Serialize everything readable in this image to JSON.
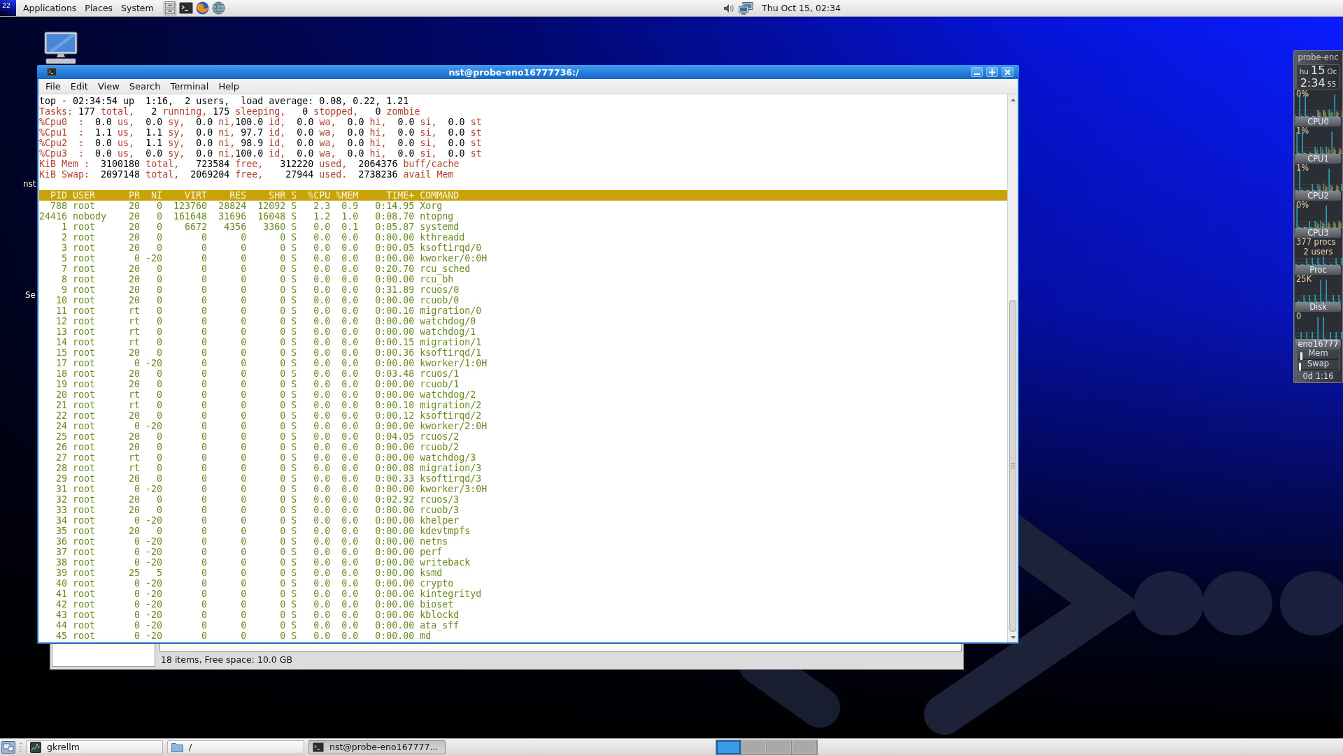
{
  "top_panel": {
    "logo_text": "22",
    "menus": [
      "Applications",
      "Places",
      "System"
    ],
    "clock": "Thu Oct 15, 02:34"
  },
  "desktop": {
    "icon_labels": [
      "nst",
      "Se"
    ]
  },
  "terminal": {
    "title": "nst@probe-eno16777736:/",
    "menus": [
      "File",
      "Edit",
      "View",
      "Search",
      "Terminal",
      "Help"
    ],
    "summary": [
      {
        "segments": [
          {
            "kind": "value",
            "text": "top - 02:34:54 up  1:16,  2 users,  load average: 0.08, 0.22, 1.21"
          }
        ]
      },
      {
        "segments": [
          {
            "kind": "label",
            "text": "Tasks:"
          },
          {
            "kind": "value",
            "text": " 177 "
          },
          {
            "kind": "label",
            "text": "total,"
          },
          {
            "kind": "value",
            "text": "   2 "
          },
          {
            "kind": "label",
            "text": "running,"
          },
          {
            "kind": "value",
            "text": " 175 "
          },
          {
            "kind": "label",
            "text": "sleeping,"
          },
          {
            "kind": "value",
            "text": "   0 "
          },
          {
            "kind": "label",
            "text": "stopped,"
          },
          {
            "kind": "value",
            "text": "   0 "
          },
          {
            "kind": "label",
            "text": "zombie"
          }
        ]
      },
      {
        "segments": [
          {
            "kind": "label",
            "text": "%Cpu0  :"
          },
          {
            "kind": "value",
            "text": "  0.0 "
          },
          {
            "kind": "label",
            "text": "us,"
          },
          {
            "kind": "value",
            "text": "  0.0 "
          },
          {
            "kind": "label",
            "text": "sy,"
          },
          {
            "kind": "value",
            "text": "  0.0 "
          },
          {
            "kind": "label",
            "text": "ni,"
          },
          {
            "kind": "value",
            "text": "100.0 "
          },
          {
            "kind": "label",
            "text": "id,"
          },
          {
            "kind": "value",
            "text": "  0.0 "
          },
          {
            "kind": "label",
            "text": "wa,"
          },
          {
            "kind": "value",
            "text": "  0.0 "
          },
          {
            "kind": "label",
            "text": "hi,"
          },
          {
            "kind": "value",
            "text": "  0.0 "
          },
          {
            "kind": "label",
            "text": "si,"
          },
          {
            "kind": "value",
            "text": "  0.0 "
          },
          {
            "kind": "label",
            "text": "st"
          }
        ]
      },
      {
        "segments": [
          {
            "kind": "label",
            "text": "%Cpu1  :"
          },
          {
            "kind": "value",
            "text": "  1.1 "
          },
          {
            "kind": "label",
            "text": "us,"
          },
          {
            "kind": "value",
            "text": "  1.1 "
          },
          {
            "kind": "label",
            "text": "sy,"
          },
          {
            "kind": "value",
            "text": "  0.0 "
          },
          {
            "kind": "label",
            "text": "ni,"
          },
          {
            "kind": "value",
            "text": " 97.7 "
          },
          {
            "kind": "label",
            "text": "id,"
          },
          {
            "kind": "value",
            "text": "  0.0 "
          },
          {
            "kind": "label",
            "text": "wa,"
          },
          {
            "kind": "value",
            "text": "  0.0 "
          },
          {
            "kind": "label",
            "text": "hi,"
          },
          {
            "kind": "value",
            "text": "  0.0 "
          },
          {
            "kind": "label",
            "text": "si,"
          },
          {
            "kind": "value",
            "text": "  0.0 "
          },
          {
            "kind": "label",
            "text": "st"
          }
        ]
      },
      {
        "segments": [
          {
            "kind": "label",
            "text": "%Cpu2  :"
          },
          {
            "kind": "value",
            "text": "  0.0 "
          },
          {
            "kind": "label",
            "text": "us,"
          },
          {
            "kind": "value",
            "text": "  1.1 "
          },
          {
            "kind": "label",
            "text": "sy,"
          },
          {
            "kind": "value",
            "text": "  0.0 "
          },
          {
            "kind": "label",
            "text": "ni,"
          },
          {
            "kind": "value",
            "text": " 98.9 "
          },
          {
            "kind": "label",
            "text": "id,"
          },
          {
            "kind": "value",
            "text": "  0.0 "
          },
          {
            "kind": "label",
            "text": "wa,"
          },
          {
            "kind": "value",
            "text": "  0.0 "
          },
          {
            "kind": "label",
            "text": "hi,"
          },
          {
            "kind": "value",
            "text": "  0.0 "
          },
          {
            "kind": "label",
            "text": "si,"
          },
          {
            "kind": "value",
            "text": "  0.0 "
          },
          {
            "kind": "label",
            "text": "st"
          }
        ]
      },
      {
        "segments": [
          {
            "kind": "label",
            "text": "%Cpu3  :"
          },
          {
            "kind": "value",
            "text": "  0.0 "
          },
          {
            "kind": "label",
            "text": "us,"
          },
          {
            "kind": "value",
            "text": "  0.0 "
          },
          {
            "kind": "label",
            "text": "sy,"
          },
          {
            "kind": "value",
            "text": "  0.0 "
          },
          {
            "kind": "label",
            "text": "ni,"
          },
          {
            "kind": "value",
            "text": "100.0 "
          },
          {
            "kind": "label",
            "text": "id,"
          },
          {
            "kind": "value",
            "text": "  0.0 "
          },
          {
            "kind": "label",
            "text": "wa,"
          },
          {
            "kind": "value",
            "text": "  0.0 "
          },
          {
            "kind": "label",
            "text": "hi,"
          },
          {
            "kind": "value",
            "text": "  0.0 "
          },
          {
            "kind": "label",
            "text": "si,"
          },
          {
            "kind": "value",
            "text": "  0.0 "
          },
          {
            "kind": "label",
            "text": "st"
          }
        ]
      },
      {
        "segments": [
          {
            "kind": "label",
            "text": "KiB Mem :"
          },
          {
            "kind": "value",
            "text": "  3100180 "
          },
          {
            "kind": "label",
            "text": "total,"
          },
          {
            "kind": "value",
            "text": "   723584 "
          },
          {
            "kind": "label",
            "text": "free,"
          },
          {
            "kind": "value",
            "text": "   312220 "
          },
          {
            "kind": "label",
            "text": "used,"
          },
          {
            "kind": "value",
            "text": "  2064376 "
          },
          {
            "kind": "label",
            "text": "buff/cache"
          }
        ]
      },
      {
        "segments": [
          {
            "kind": "label",
            "text": "KiB Swap:"
          },
          {
            "kind": "value",
            "text": "  2097148 "
          },
          {
            "kind": "label",
            "text": "total,"
          },
          {
            "kind": "value",
            "text": "  2069204 "
          },
          {
            "kind": "label",
            "text": "free,"
          },
          {
            "kind": "value",
            "text": "    27944 "
          },
          {
            "kind": "label",
            "text": "used."
          },
          {
            "kind": "value",
            "text": "  2738236 "
          },
          {
            "kind": "label",
            "text": "avail Mem"
          }
        ]
      }
    ],
    "process_table": {
      "columns": [
        "PID",
        "USER",
        "PR",
        "NI",
        "VIRT",
        "RES",
        "SHR",
        "S",
        "%CPU",
        "%MEM",
        "TIME+",
        "COMMAND"
      ],
      "rows": [
        [
          "788",
          "root",
          "20",
          "0",
          "123760",
          "28824",
          "12092",
          "S",
          "2.3",
          "0.9",
          "0:14.95",
          "Xorg"
        ],
        [
          "24416",
          "nobody",
          "20",
          "0",
          "161648",
          "31696",
          "16048",
          "S",
          "1.2",
          "1.0",
          "0:08.70",
          "ntopng"
        ],
        [
          "1",
          "root",
          "20",
          "0",
          "6672",
          "4356",
          "3360",
          "S",
          "0.0",
          "0.1",
          "0:05.87",
          "systemd"
        ],
        [
          "2",
          "root",
          "20",
          "0",
          "0",
          "0",
          "0",
          "S",
          "0.0",
          "0.0",
          "0:00.00",
          "kthreadd"
        ],
        [
          "3",
          "root",
          "20",
          "0",
          "0",
          "0",
          "0",
          "S",
          "0.0",
          "0.0",
          "0:00.05",
          "ksoftirqd/0"
        ],
        [
          "5",
          "root",
          "0",
          "-20",
          "0",
          "0",
          "0",
          "S",
          "0.0",
          "0.0",
          "0:00.00",
          "kworker/0:0H"
        ],
        [
          "7",
          "root",
          "20",
          "0",
          "0",
          "0",
          "0",
          "S",
          "0.0",
          "0.0",
          "0:20.70",
          "rcu_sched"
        ],
        [
          "8",
          "root",
          "20",
          "0",
          "0",
          "0",
          "0",
          "S",
          "0.0",
          "0.0",
          "0:00.00",
          "rcu_bh"
        ],
        [
          "9",
          "root",
          "20",
          "0",
          "0",
          "0",
          "0",
          "S",
          "0.0",
          "0.0",
          "0:31.89",
          "rcuos/0"
        ],
        [
          "10",
          "root",
          "20",
          "0",
          "0",
          "0",
          "0",
          "S",
          "0.0",
          "0.0",
          "0:00.00",
          "rcuob/0"
        ],
        [
          "11",
          "root",
          "rt",
          "0",
          "0",
          "0",
          "0",
          "S",
          "0.0",
          "0.0",
          "0:00.10",
          "migration/0"
        ],
        [
          "12",
          "root",
          "rt",
          "0",
          "0",
          "0",
          "0",
          "S",
          "0.0",
          "0.0",
          "0:00.00",
          "watchdog/0"
        ],
        [
          "13",
          "root",
          "rt",
          "0",
          "0",
          "0",
          "0",
          "S",
          "0.0",
          "0.0",
          "0:00.00",
          "watchdog/1"
        ],
        [
          "14",
          "root",
          "rt",
          "0",
          "0",
          "0",
          "0",
          "S",
          "0.0",
          "0.0",
          "0:00.15",
          "migration/1"
        ],
        [
          "15",
          "root",
          "20",
          "0",
          "0",
          "0",
          "0",
          "S",
          "0.0",
          "0.0",
          "0:00.36",
          "ksoftirqd/1"
        ],
        [
          "17",
          "root",
          "0",
          "-20",
          "0",
          "0",
          "0",
          "S",
          "0.0",
          "0.0",
          "0:00.00",
          "kworker/1:0H"
        ],
        [
          "18",
          "root",
          "20",
          "0",
          "0",
          "0",
          "0",
          "S",
          "0.0",
          "0.0",
          "0:03.48",
          "rcuos/1"
        ],
        [
          "19",
          "root",
          "20",
          "0",
          "0",
          "0",
          "0",
          "S",
          "0.0",
          "0.0",
          "0:00.00",
          "rcuob/1"
        ],
        [
          "20",
          "root",
          "rt",
          "0",
          "0",
          "0",
          "0",
          "S",
          "0.0",
          "0.0",
          "0:00.00",
          "watchdog/2"
        ],
        [
          "21",
          "root",
          "rt",
          "0",
          "0",
          "0",
          "0",
          "S",
          "0.0",
          "0.0",
          "0:00.10",
          "migration/2"
        ],
        [
          "22",
          "root",
          "20",
          "0",
          "0",
          "0",
          "0",
          "S",
          "0.0",
          "0.0",
          "0:00.12",
          "ksoftirqd/2"
        ],
        [
          "24",
          "root",
          "0",
          "-20",
          "0",
          "0",
          "0",
          "S",
          "0.0",
          "0.0",
          "0:00.00",
          "kworker/2:0H"
        ],
        [
          "25",
          "root",
          "20",
          "0",
          "0",
          "0",
          "0",
          "S",
          "0.0",
          "0.0",
          "0:04.05",
          "rcuos/2"
        ],
        [
          "26",
          "root",
          "20",
          "0",
          "0",
          "0",
          "0",
          "S",
          "0.0",
          "0.0",
          "0:00.00",
          "rcuob/2"
        ],
        [
          "27",
          "root",
          "rt",
          "0",
          "0",
          "0",
          "0",
          "S",
          "0.0",
          "0.0",
          "0:00.00",
          "watchdog/3"
        ],
        [
          "28",
          "root",
          "rt",
          "0",
          "0",
          "0",
          "0",
          "S",
          "0.0",
          "0.0",
          "0:00.08",
          "migration/3"
        ],
        [
          "29",
          "root",
          "20",
          "0",
          "0",
          "0",
          "0",
          "S",
          "0.0",
          "0.0",
          "0:00.33",
          "ksoftirqd/3"
        ],
        [
          "31",
          "root",
          "0",
          "-20",
          "0",
          "0",
          "0",
          "S",
          "0.0",
          "0.0",
          "0:00.00",
          "kworker/3:0H"
        ],
        [
          "32",
          "root",
          "20",
          "0",
          "0",
          "0",
          "0",
          "S",
          "0.0",
          "0.0",
          "0:02.92",
          "rcuos/3"
        ],
        [
          "33",
          "root",
          "20",
          "0",
          "0",
          "0",
          "0",
          "S",
          "0.0",
          "0.0",
          "0:00.00",
          "rcuob/3"
        ],
        [
          "34",
          "root",
          "0",
          "-20",
          "0",
          "0",
          "0",
          "S",
          "0.0",
          "0.0",
          "0:00.00",
          "khelper"
        ],
        [
          "35",
          "root",
          "20",
          "0",
          "0",
          "0",
          "0",
          "S",
          "0.0",
          "0.0",
          "0:00.00",
          "kdevtmpfs"
        ],
        [
          "36",
          "root",
          "0",
          "-20",
          "0",
          "0",
          "0",
          "S",
          "0.0",
          "0.0",
          "0:00.00",
          "netns"
        ],
        [
          "37",
          "root",
          "0",
          "-20",
          "0",
          "0",
          "0",
          "S",
          "0.0",
          "0.0",
          "0:00.00",
          "perf"
        ],
        [
          "38",
          "root",
          "0",
          "-20",
          "0",
          "0",
          "0",
          "S",
          "0.0",
          "0.0",
          "0:00.00",
          "writeback"
        ],
        [
          "39",
          "root",
          "25",
          "5",
          "0",
          "0",
          "0",
          "S",
          "0.0",
          "0.0",
          "0:00.00",
          "ksmd"
        ],
        [
          "40",
          "root",
          "0",
          "-20",
          "0",
          "0",
          "0",
          "S",
          "0.0",
          "0.0",
          "0:00.00",
          "crypto"
        ],
        [
          "41",
          "root",
          "0",
          "-20",
          "0",
          "0",
          "0",
          "S",
          "0.0",
          "0.0",
          "0:00.00",
          "kintegrityd"
        ],
        [
          "42",
          "root",
          "0",
          "-20",
          "0",
          "0",
          "0",
          "S",
          "0.0",
          "0.0",
          "0:00.00",
          "bioset"
        ],
        [
          "43",
          "root",
          "0",
          "-20",
          "0",
          "0",
          "0",
          "S",
          "0.0",
          "0.0",
          "0:00.00",
          "kblockd"
        ],
        [
          "44",
          "root",
          "0",
          "-20",
          "0",
          "0",
          "0",
          "S",
          "0.0",
          "0.0",
          "0:00.00",
          "ata_sff"
        ],
        [
          "45",
          "root",
          "0",
          "-20",
          "0",
          "0",
          "0",
          "S",
          "0.0",
          "0.0",
          "0:00.00",
          "md"
        ]
      ]
    }
  },
  "file_manager": {
    "status": "18 items, Free space: 10.0 GB"
  },
  "gkrellm": {
    "hostname": "probe-enc",
    "date": {
      "weekday": "hu",
      "day": "15",
      "month": "Oc"
    },
    "time": {
      "hours_minutes": "2:34",
      "seconds": "55"
    },
    "monitors": [
      {
        "kind": "cpu",
        "label": "CPU0",
        "readings": [
          "0%"
        ]
      },
      {
        "kind": "cpu",
        "label": "CPU1",
        "readings": [
          "1%"
        ]
      },
      {
        "kind": "cpu",
        "label": "CPU2",
        "readings": [
          "1%"
        ]
      },
      {
        "kind": "cpu",
        "label": "CPU3",
        "readings": [
          "0%"
        ]
      },
      {
        "kind": "proc",
        "label": "Proc",
        "readings": [
          "377 procs",
          "2 users"
        ]
      },
      {
        "kind": "disk",
        "label": "Disk",
        "readings": [
          "25K"
        ]
      },
      {
        "kind": "net",
        "label": "eno16777",
        "readings": [
          "0"
        ]
      }
    ],
    "meters": [
      {
        "label": "Mem",
        "level": 0.05
      },
      {
        "label": "Swap",
        "level": 0.02
      }
    ],
    "uptime": "0d 1:16"
  },
  "taskbar": {
    "tasks": [
      {
        "label": "gkrellm",
        "selected": false
      },
      {
        "label": "/",
        "selected": false
      },
      {
        "label": "nst@probe-eno167777...",
        "selected": true
      }
    ],
    "workspaces": [
      {
        "selected": true
      },
      {
        "selected": false
      },
      {
        "selected": false
      },
      {
        "selected": false
      }
    ]
  }
}
